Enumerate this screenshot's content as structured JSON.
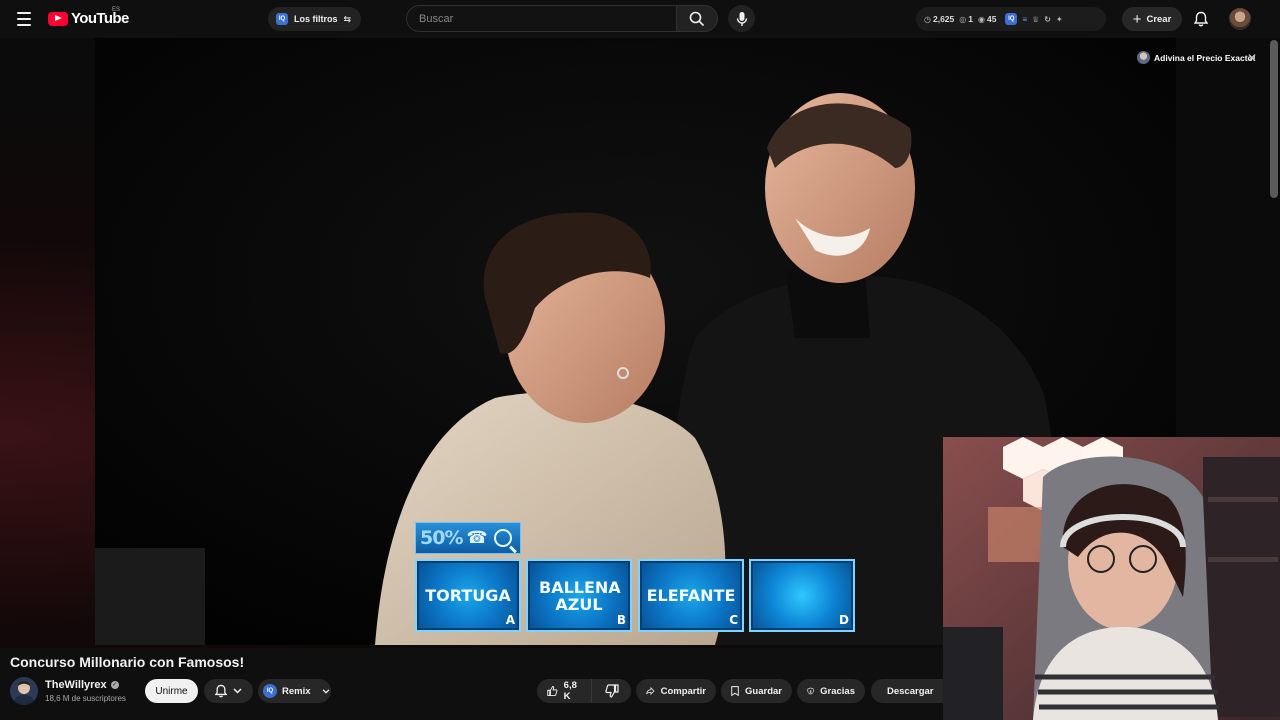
{
  "app": {
    "logo_text": "YouTube",
    "region": "ES"
  },
  "header": {
    "filters_label": "Los filtros",
    "filters_badge": "IQ",
    "search_placeholder": "Buscar",
    "extension_stats": {
      "points": "2,625",
      "active": "1",
      "viewers": "45",
      "badge": "IQ"
    },
    "create_label": "Crear"
  },
  "video_overlay": {
    "channel_chip": "Adivina el Precio Exacto!",
    "quiz": {
      "lifeline_percent": "50%",
      "answers": [
        {
          "text": "TORTUGA",
          "letter": "A"
        },
        {
          "text": "BALLENA AZUL",
          "letter": "B"
        },
        {
          "text": "ELEFANTE",
          "letter": "C"
        },
        {
          "text": "",
          "letter": "D"
        }
      ]
    }
  },
  "video": {
    "title": "Concurso Millonario con Famosos!",
    "channel_name": "TheWillyrex",
    "subscribers": "18,6 M de suscriptores",
    "join_label": "Unirme",
    "remix_label": "Remix",
    "remix_badge": "IQ",
    "likes": "6,8 K",
    "share_label": "Compartir",
    "save_label": "Guardar",
    "thanks_label": "Gracias",
    "download_label": "Descargar"
  },
  "colors": {
    "brand_red": "#ff0033",
    "background": "#0f0f0f",
    "quiz_blue": "#0b74c4",
    "pill_bg": "#272727"
  },
  "icons": [
    "menu-icon",
    "youtube-logo-icon",
    "sliders-icon",
    "search-icon",
    "mic-icon",
    "clock-icon",
    "eye-icon",
    "trophy-icon",
    "plus-icon",
    "bell-icon",
    "close-icon",
    "verified-icon",
    "chevron-down-icon",
    "thumbs-up-icon",
    "thumbs-down-icon",
    "share-icon",
    "bookmark-icon",
    "thanks-icon",
    "download-icon",
    "phone-icon",
    "magnifier-icon"
  ]
}
